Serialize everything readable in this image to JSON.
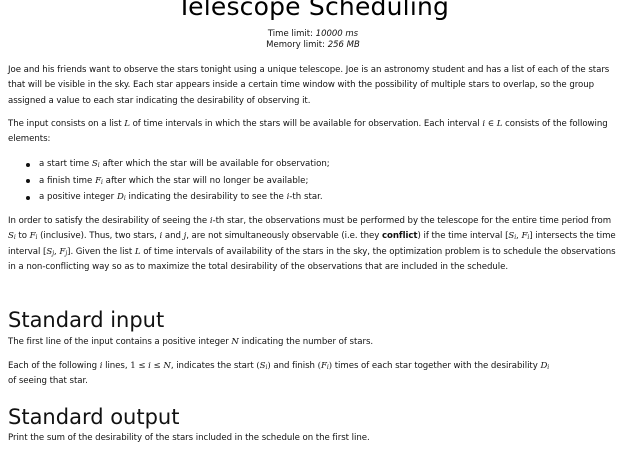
{
  "title": "Telescope Scheduling",
  "limits": {
    "time_label": "Time limit:",
    "time_value": "10000 ms",
    "memory_label": "Memory limit:",
    "memory_value": "256 MB"
  },
  "intro": "Joe and his friends want to observe the stars tonight using a unique telescope. Joe is an astronomy student and has a list of each of the stars that will be visible in the sky. Each star appears inside a certain time window with the possibility of multiple stars to overlap, so the group assigned a value to each star indicating the desirability of observing it.",
  "input_desc": {
    "p1": "The input consists on a list ",
    "m1": "L",
    "p2": " of time intervals in which the stars will be available for observation. Each interval ",
    "m2": "i",
    "m2op": " ∈ ",
    "m3": "L",
    "p3": " consists of the following elements:"
  },
  "bullets": [
    {
      "pre": "a start time ",
      "sym": "S",
      "sub": "i",
      "post": " after which the star will be available for observation;"
    },
    {
      "pre": "a finish time ",
      "sym": "F",
      "sub": "i",
      "post": " after which the star will no longer be available;"
    },
    {
      "pre": "a positive integer ",
      "sym": "D",
      "sub": "i",
      "post": " indicating the desirability to see the ",
      "sym2": "i",
      "post2": "-th star."
    }
  ],
  "conflict_para": {
    "a": "In order to satisfy the desirability of seeing the ",
    "b": "-th star, the observations must be performed by the telescope for the entire time period from ",
    "c": " to ",
    "d": " (inclusive). Thus, two stars, ",
    "e": " and ",
    "f": ", are not simultaneously observable (i.e. they ",
    "conflict": "conflict",
    "g": ") if the time interval ",
    "h": " intersects the time interval ",
    "i": ". Given the list ",
    "j": " of time intervals of availability of the stars in the sky, the optimization problem is to schedule the observations in a non-conflicting way so as to maximize the total desirability of the observations that are included in the schedule."
  },
  "standard_input": {
    "heading": "Standard input",
    "line1_a": "The first line of the input contains a positive integer ",
    "line1_m": "N",
    "line1_b": " indicating the number of stars.",
    "line2_a": "Each of the following ",
    "line2_b": " lines, ",
    "line2_c": ", indicates the start ",
    "line2_d": " and finish ",
    "line2_e": " times of each star together with the desirability ",
    "line2_f": "of seeing that star."
  },
  "standard_output": {
    "heading": "Standard output",
    "line": "Print the sum of the desirability of the stars included in the schedule on the first line."
  }
}
